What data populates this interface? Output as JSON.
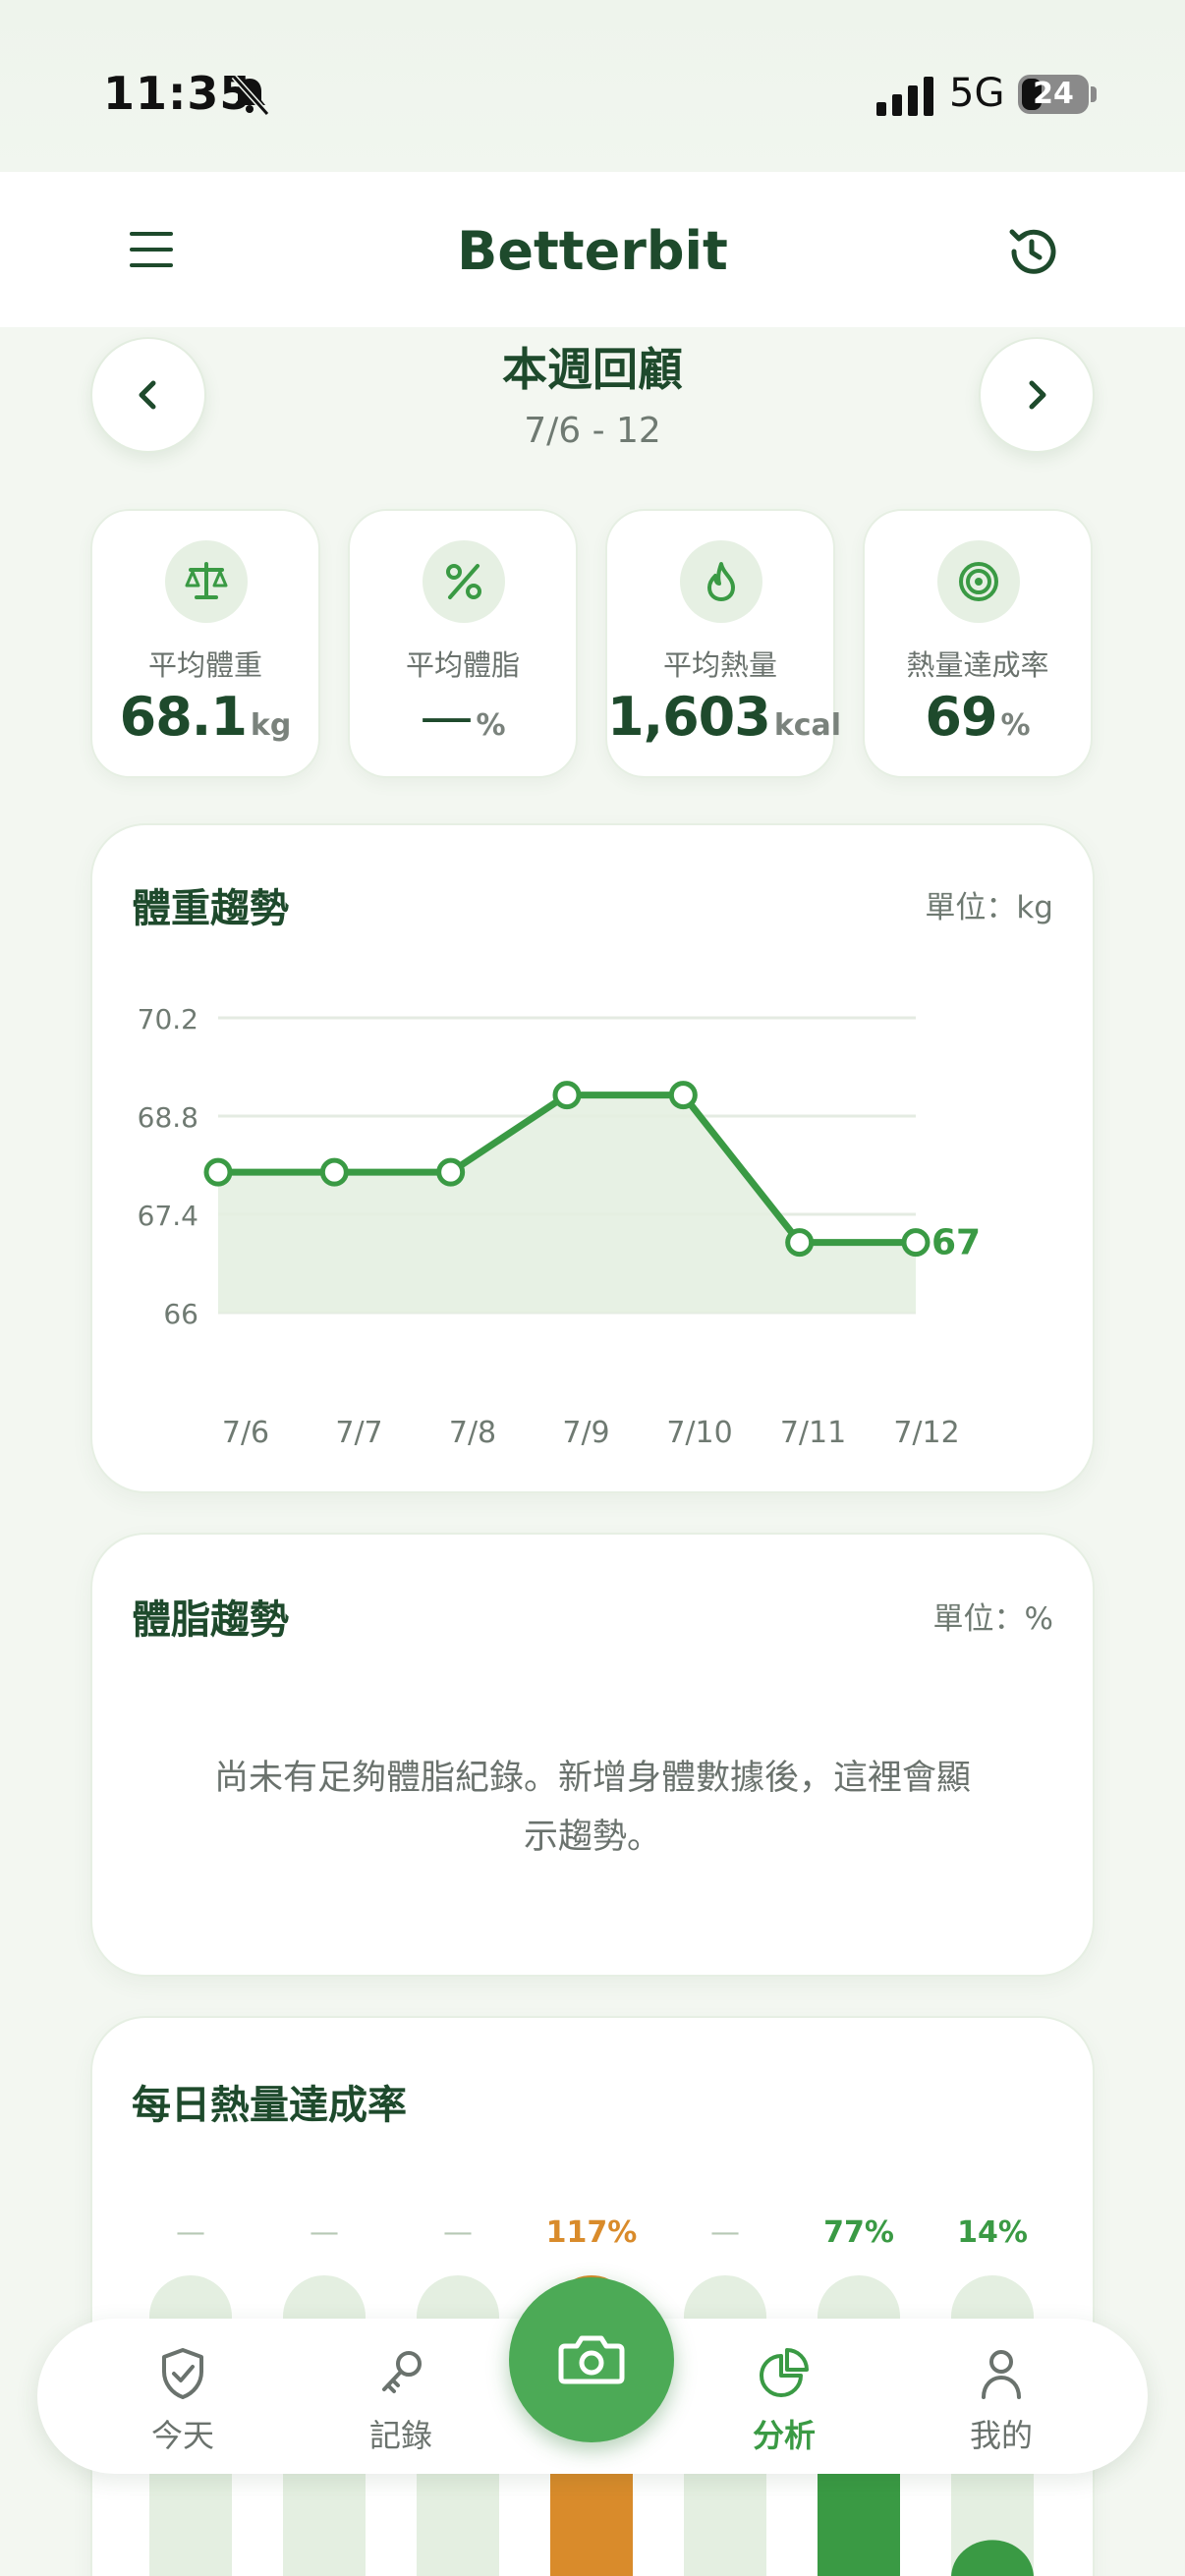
{
  "status_bar": {
    "time": "11:35",
    "network": "5G",
    "battery": "24"
  },
  "header": {
    "title": "Betterbit"
  },
  "week": {
    "title": "本週回顧",
    "range": "7/6 - 12"
  },
  "stats": [
    {
      "label": "平均體重",
      "value": "68.1",
      "unit": "kg",
      "icon": "scale-icon"
    },
    {
      "label": "平均體脂",
      "value": "—",
      "unit": "%",
      "icon": "percent-icon"
    },
    {
      "label": "平均熱量",
      "value": "1,603",
      "unit": "kcal",
      "icon": "flame-icon"
    },
    {
      "label": "熱量達成率",
      "value": "69",
      "unit": "%",
      "icon": "target-icon"
    }
  ],
  "weight_card": {
    "title": "體重趨勢",
    "unit": "單位：kg"
  },
  "bodyfat_card": {
    "title": "體脂趨勢",
    "unit": "單位：%",
    "empty_line1": "尚未有足夠體脂紀錄。新增身體數據後，這裡會顯",
    "empty_line2": "示趨勢。"
  },
  "calorie_card": {
    "title": "每日熱量達成率"
  },
  "tabs": [
    {
      "label": "今天",
      "icon": "shield-icon"
    },
    {
      "label": "記錄",
      "icon": "key-icon"
    },
    {
      "label": "分析",
      "icon": "pie-chart-icon",
      "active": true
    },
    {
      "label": "我的",
      "icon": "person-icon"
    }
  ],
  "colors": {
    "accent": "#3a9a44",
    "dark_green": "#1e4a2c",
    "orange": "#d98b2b",
    "light_green": "#e4efe1"
  },
  "chart_data": [
    {
      "type": "line",
      "x": [
        "7/6",
        "7/7",
        "7/8",
        "7/9",
        "7/10",
        "7/11",
        "7/12"
      ],
      "series": [
        {
          "values": [
            68.0,
            68.0,
            68.0,
            69.1,
            69.1,
            67.0,
            67.0
          ]
        }
      ],
      "yticks": [
        "70.2",
        "68.8",
        "67.4",
        "66"
      ],
      "ylim": [
        66,
        70.2
      ],
      "last_label": "67",
      "grid": true
    },
    {
      "type": "bar",
      "labels": [
        "—",
        "—",
        "—",
        "117%",
        "—",
        "77%",
        "14%"
      ],
      "values": [
        null,
        null,
        null,
        117,
        null,
        77,
        14
      ]
    }
  ]
}
